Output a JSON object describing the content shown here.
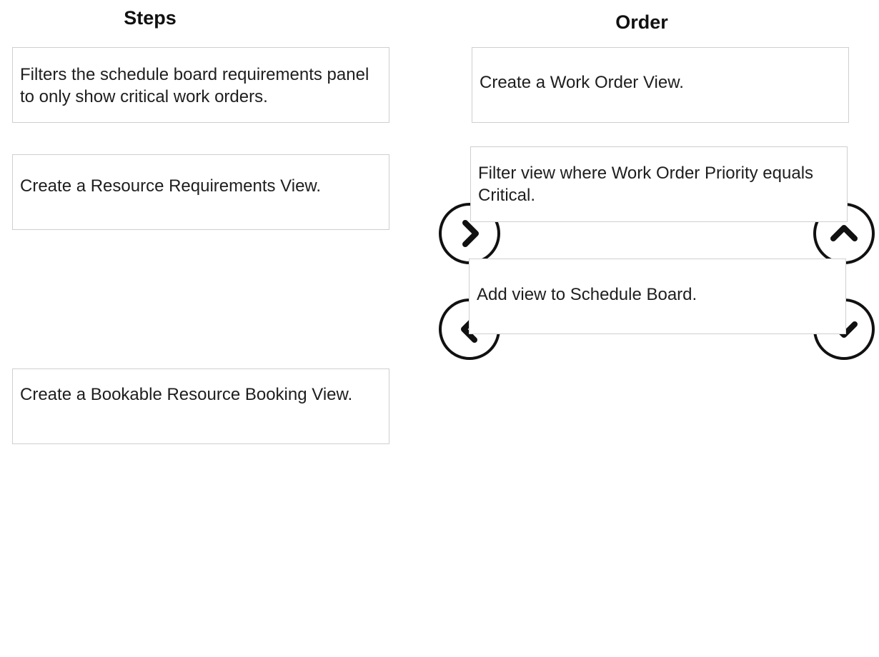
{
  "headings": {
    "steps": "Steps",
    "order": "Order"
  },
  "steps": [
    {
      "text": "Filters the schedule board requirements panel to only show critical work orders."
    },
    {
      "text": "Create a Resource Requirements View."
    },
    {
      "text": "Create a Bookable Resource Booking View."
    }
  ],
  "order": [
    {
      "text": "Create a Work Order View."
    },
    {
      "text": "Filter view where Work Order Priority equals Critical."
    },
    {
      "text": "Add view to Schedule Board."
    }
  ],
  "controls": {
    "move_right_icon": "chevron-right-icon",
    "move_left_icon": "chevron-left-icon",
    "move_up_icon": "chevron-up-icon",
    "move_down_icon": "chevron-down-icon"
  },
  "colors": {
    "box_border": "#cfcfcf",
    "button_stroke": "#111111",
    "text": "#1e1e1e"
  }
}
